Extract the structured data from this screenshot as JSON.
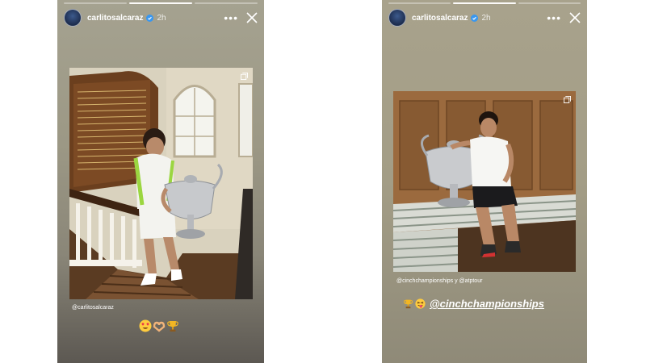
{
  "stories": [
    {
      "username": "carlitosalcaraz",
      "time": "2h",
      "mention": "@carlitosalcaraz",
      "emojis": [
        "heart-eyes",
        "heart-hands",
        "trophy"
      ]
    },
    {
      "username": "carlitosalcaraz",
      "time": "2h",
      "mention": "@cinchchampionships y @atptour",
      "emojis": [
        "trophy",
        "winking-tongue"
      ],
      "hashtag": "@cinchchampionships"
    }
  ],
  "more_label": "•••",
  "colors": {
    "verified": "#3897f0",
    "text": "#ffffff"
  }
}
